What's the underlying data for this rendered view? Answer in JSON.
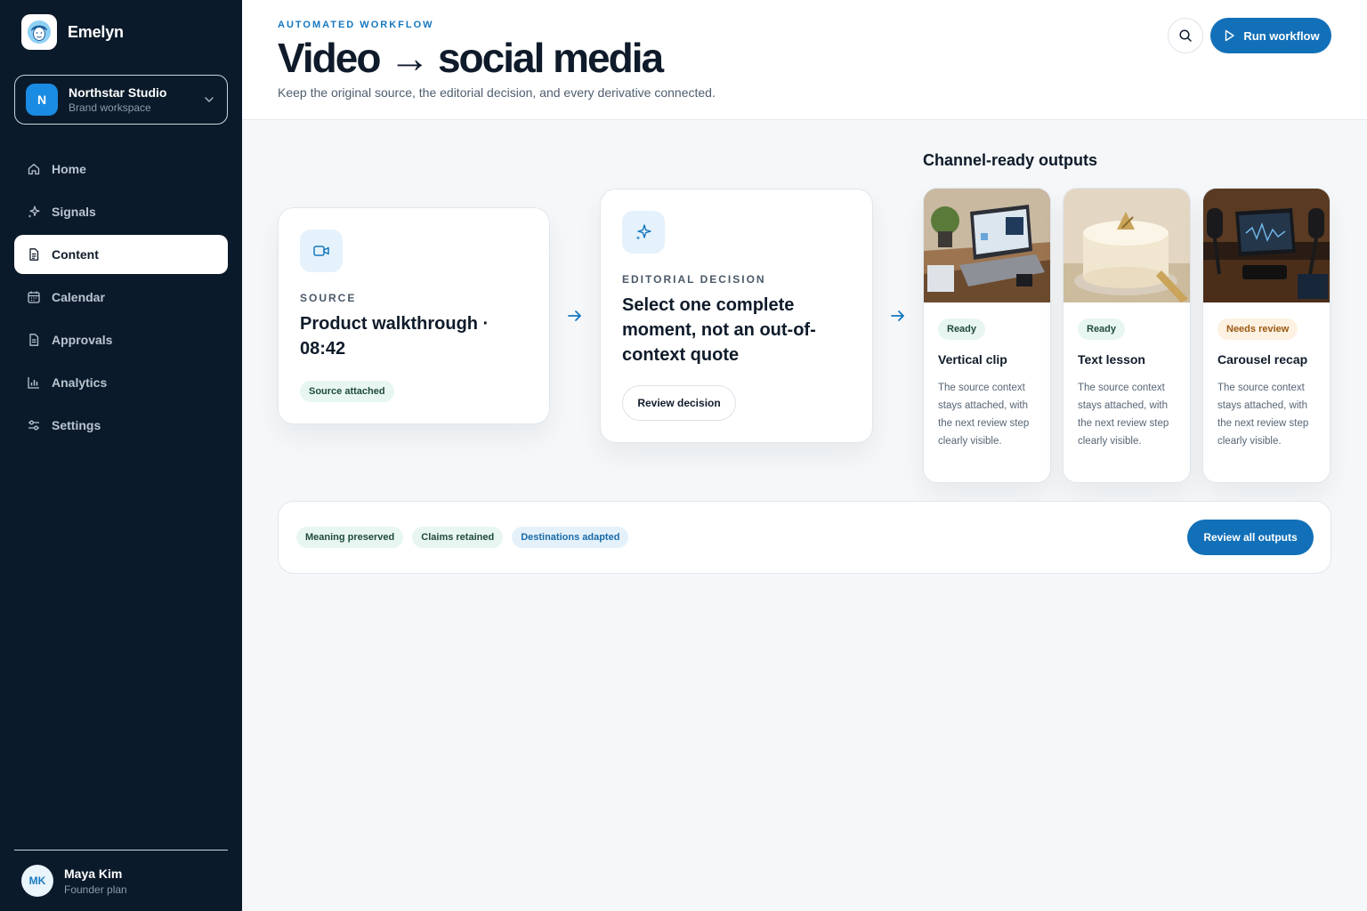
{
  "brand": {
    "name": "Emelyn"
  },
  "workspace": {
    "initial": "N",
    "name": "Northstar Studio",
    "subtitle": "Brand workspace"
  },
  "nav": [
    {
      "label": "Home",
      "icon": "home-icon",
      "active": false
    },
    {
      "label": "Signals",
      "icon": "sparkle-icon",
      "active": false
    },
    {
      "label": "Content",
      "icon": "document-icon",
      "active": true
    },
    {
      "label": "Calendar",
      "icon": "calendar-icon",
      "active": false
    },
    {
      "label": "Approvals",
      "icon": "document-check-icon",
      "active": false
    },
    {
      "label": "Analytics",
      "icon": "bar-chart-icon",
      "active": false
    },
    {
      "label": "Settings",
      "icon": "sliders-icon",
      "active": false
    }
  ],
  "user": {
    "initials": "MK",
    "name": "Maya Kim",
    "plan": "Founder plan"
  },
  "header": {
    "eyebrow": "AUTOMATED WORKFLOW",
    "title": "Video → social media",
    "subtitle": "Keep the original source, the editorial decision, and every derivative connected.",
    "run_label": "Run workflow"
  },
  "source": {
    "label": "SOURCE",
    "title": "Product walkthrough · 08:42",
    "badge": "Source attached"
  },
  "decision": {
    "label": "EDITORIAL DECISION",
    "title": "Select one complete moment, not an out-of-context quote",
    "button": "Review decision"
  },
  "outputs": {
    "heading": "Channel-ready outputs",
    "items": [
      {
        "status": "Ready",
        "status_color": "green",
        "title": "Vertical clip",
        "desc": "The source context stays attached, with the next review step clearly visible."
      },
      {
        "status": "Ready",
        "status_color": "green",
        "title": "Text lesson",
        "desc": "The source context stays attached, with the next review step clearly visible."
      },
      {
        "status": "Needs review",
        "status_color": "orange",
        "title": "Carousel recap",
        "desc": "The source context stays attached, with the next review step clearly visible."
      }
    ]
  },
  "checks": {
    "chips": [
      "Meaning preserved",
      "Claims retained",
      "Destinations adapted"
    ],
    "button": "Review all outputs"
  },
  "colors": {
    "sidebar": "#0b1a2a",
    "accent": "#1270b8",
    "ready_bg": "#e8f6f1",
    "review_bg": "#fdf1e2"
  }
}
